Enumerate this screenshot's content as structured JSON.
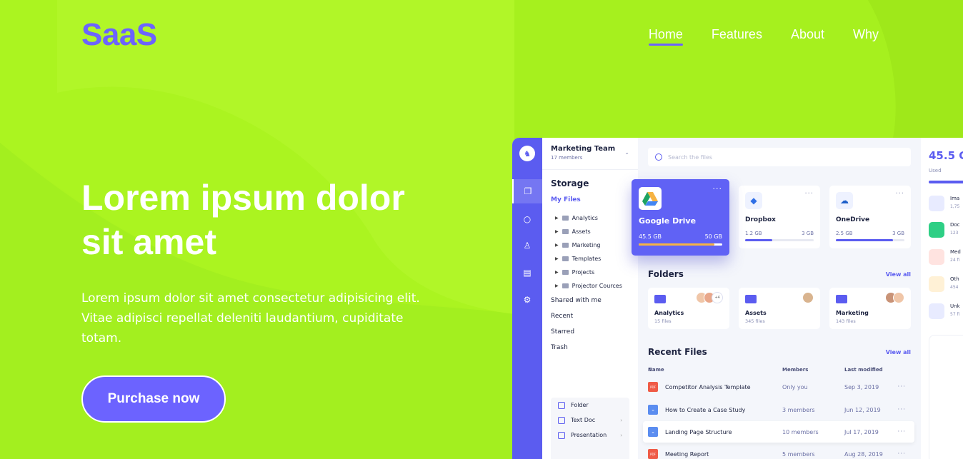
{
  "brand": "SaaS",
  "nav": [
    {
      "label": "Home",
      "active": true
    },
    {
      "label": "Features",
      "active": false
    },
    {
      "label": "About",
      "active": false
    },
    {
      "label": "Why",
      "active": false
    }
  ],
  "hero": {
    "title": "Lorem ipsum dolor sit amet",
    "text": "Lorem ipsum dolor sit amet consectetur adipisicing elit. Vitae adipisci repellat deleniti laudantium, cupiditate totam.",
    "cta": "Purchase now"
  },
  "colors": {
    "background": "#a6f01e",
    "accent": "#6c63ff",
    "dashboard_primary": "#5b5cf0"
  },
  "dashboard": {
    "team": {
      "name": "Marketing Team",
      "members": "17 members"
    },
    "storage_title": "Storage",
    "my_files": "My Files",
    "tree": [
      "Analytics",
      "Assets",
      "Marketing",
      "Templates",
      "Projects",
      "Projector Cources"
    ],
    "links": [
      "Shared with me",
      "Recent",
      "Starred",
      "Trash"
    ],
    "new_items": [
      "Folder",
      "Text Doc",
      "Presentation"
    ],
    "search_placeholder": "Search the files",
    "cards": [
      {
        "name": "Google Drive",
        "used": "45.5 GB",
        "capacity": "50 GB",
        "fill": 0.91,
        "icon": "google-drive-icon"
      },
      {
        "name": "Dropbox",
        "used": "1.2 GB",
        "capacity": "3 GB",
        "fill": 0.4,
        "icon": "dropbox-icon"
      },
      {
        "name": "OneDrive",
        "used": "2.5 GB",
        "capacity": "3 GB",
        "fill": 0.83,
        "icon": "onedrive-icon"
      }
    ],
    "folders_title": "Folders",
    "view_all": "View all",
    "folders": [
      {
        "name": "Analytics",
        "count": "15 files",
        "extra": "+4"
      },
      {
        "name": "Assets",
        "count": "345 files",
        "extra": ""
      },
      {
        "name": "Marketing",
        "count": "143 files",
        "extra": ""
      }
    ],
    "recent_title": "Recent Files",
    "columns": {
      "name": "Name",
      "members": "Members",
      "modified": "Last modified"
    },
    "recent": [
      {
        "name": "Competitor Analysis Template",
        "members": "Only you",
        "date": "Sep 3, 2019",
        "type": "PDF",
        "color": "#ef5b47"
      },
      {
        "name": "How to Create a Case Study",
        "members": "3 members",
        "date": "Jun 12, 2019",
        "type": "DOC",
        "color": "#5b8df0"
      },
      {
        "name": "Landing Page Structure",
        "members": "10 members",
        "date": "Jul 17, 2019",
        "type": "DOC",
        "color": "#5b8df0"
      },
      {
        "name": "Meeting Report",
        "members": "5 members",
        "date": "Aug 28, 2019",
        "type": "PDF",
        "color": "#ef5b47"
      }
    ],
    "right_panel": {
      "total": "45.5 G",
      "used_label": "Used",
      "categories": [
        {
          "name": "Ima",
          "size": "1,75",
          "color": "#e8ebff"
        },
        {
          "name": "Doc",
          "size": "123",
          "color": "#2ecf85"
        },
        {
          "name": "Med",
          "size": "24 fi",
          "color": "#ef5b47"
        },
        {
          "name": "Oth",
          "size": "454",
          "color": "#f6b343"
        },
        {
          "name": "Unk",
          "size": "57 fi",
          "color": "#e8ebff"
        }
      ]
    }
  }
}
